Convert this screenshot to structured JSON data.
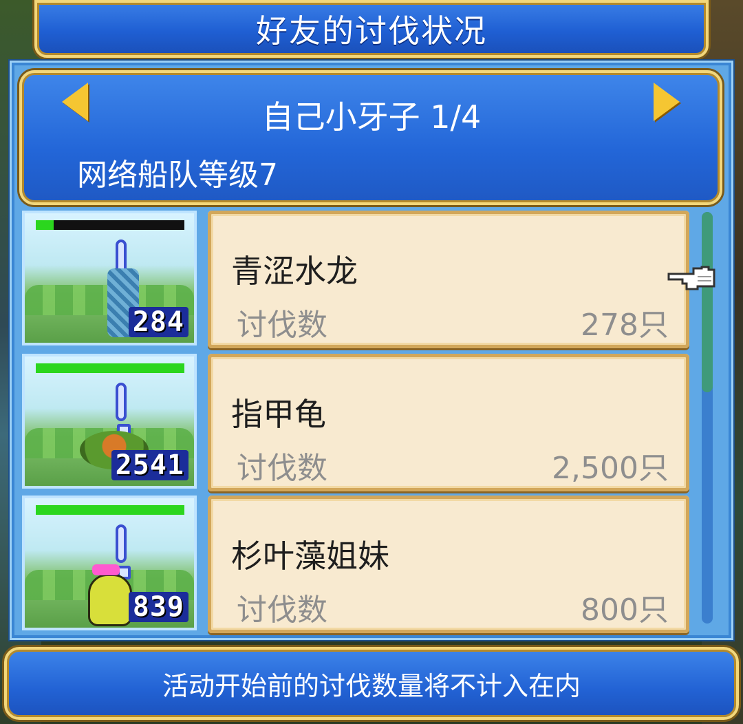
{
  "title": "好友的讨伐状况",
  "header": {
    "player_title": "自己小牙子 1/4",
    "fleet_level": "网络船队等级7"
  },
  "monsters": [
    {
      "name": "青涩水龙",
      "kill_label": "讨伐数",
      "kill_value": "278只",
      "count": "284",
      "hp_ratio": 0.12
    },
    {
      "name": "指甲龟",
      "kill_label": "讨伐数",
      "kill_value": "2,500只",
      "count": "2541",
      "hp_ratio": 1.0
    },
    {
      "name": "杉叶藻姐妹",
      "kill_label": "讨伐数",
      "kill_value": "800只",
      "count": "839",
      "hp_ratio": 1.0
    }
  ],
  "footer": {
    "note": "活动开始前的讨伐数量将不计入在内"
  },
  "icons": {
    "prev": "arrow-left-icon",
    "next": "arrow-right-icon",
    "pointer": "pointing-hand-icon"
  },
  "colors": {
    "accent": "#1f5fd3",
    "gold": "#f5c632",
    "hp": "#2bd61e"
  }
}
